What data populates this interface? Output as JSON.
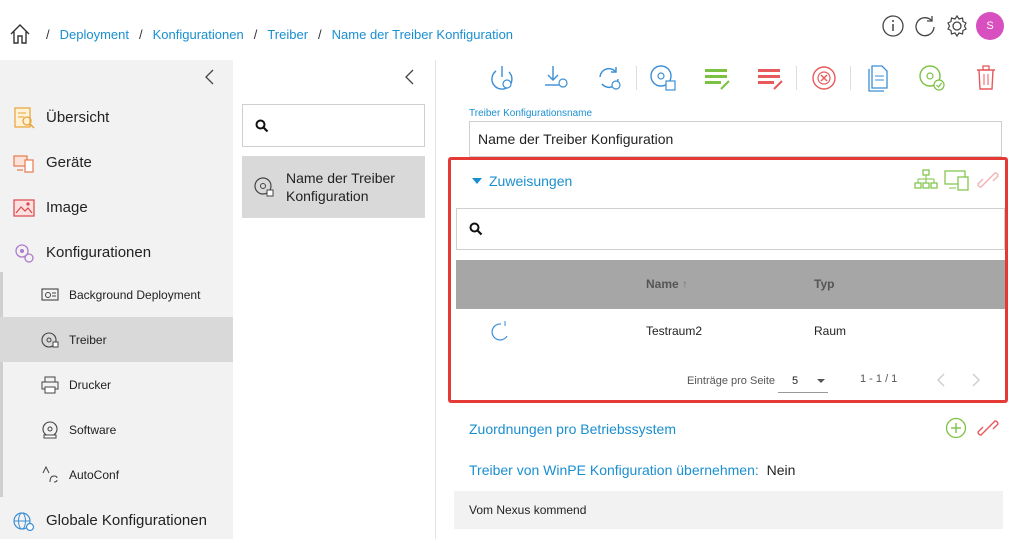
{
  "breadcrumb": {
    "items": [
      "Deployment",
      "Konfigurationen",
      "Treiber",
      "Name der Treiber Konfiguration"
    ],
    "separator": "/"
  },
  "header": {
    "icons": [
      "home-icon",
      "info-icon",
      "refresh-icon",
      "gear-icon"
    ],
    "avatar_initial": "S",
    "avatar_color": "#d84fc0"
  },
  "sidebar": {
    "main_items": [
      {
        "label": "Übersicht",
        "icon": "overview-icon"
      },
      {
        "label": "Geräte",
        "icon": "devices-icon"
      },
      {
        "label": "Image",
        "icon": "image-icon"
      },
      {
        "label": "Konfigurationen",
        "icon": "configurations-icon"
      }
    ],
    "sub_items": [
      {
        "label": "Background Deployment",
        "icon": "background-deployment-icon"
      },
      {
        "label": "Treiber",
        "icon": "driver-icon"
      },
      {
        "label": "Drucker",
        "icon": "printer-icon"
      },
      {
        "label": "Software",
        "icon": "software-icon"
      },
      {
        "label": "AutoConf",
        "icon": "autoconf-icon"
      }
    ],
    "bottom_item": {
      "label": "Globale Konfigurationen",
      "icon": "globe-config-icon"
    },
    "active_sub": "Treiber"
  },
  "middle": {
    "search_placeholder": "",
    "list_item": {
      "line1": "Name der Treiber",
      "line2": "Konfiguration"
    }
  },
  "toolbar": {
    "icons": [
      "deploy-icon",
      "download-install-icon",
      "sync-icon",
      "disc-settings-icon",
      "list-edit-icon",
      "list-remove-icon",
      "cancel-icon",
      "document-icon",
      "disc-check-icon",
      "trash-icon"
    ]
  },
  "detail": {
    "name_label": "Treiber Konfigurationsname",
    "name_value": "Name der Treiber Konfiguration",
    "assignments": {
      "title": "Zuweisungen",
      "search_placeholder": "",
      "columns": {
        "name": "Name",
        "type": "Typ"
      },
      "rows": [
        {
          "name": "Testraum2",
          "type": "Raum",
          "icon": "loading-icon"
        }
      ],
      "pager": {
        "entries_label": "Einträge pro Seite",
        "page_size": "5",
        "range": "1 - 1 / 1"
      }
    },
    "mappings_title": "Zuordnungen pro Betriebssystem",
    "winpe_label": "Treiber von WinPE Konfiguration übernehmen:",
    "winpe_value": "Nein",
    "nexus_text": "Vom Nexus kommend"
  },
  "colors": {
    "accent_blue": "#1a8fd0",
    "green": "#7cc142",
    "red": "#e53935",
    "sidebar_bg": "#f2f2f2",
    "active_bg": "#d9d9d9"
  }
}
